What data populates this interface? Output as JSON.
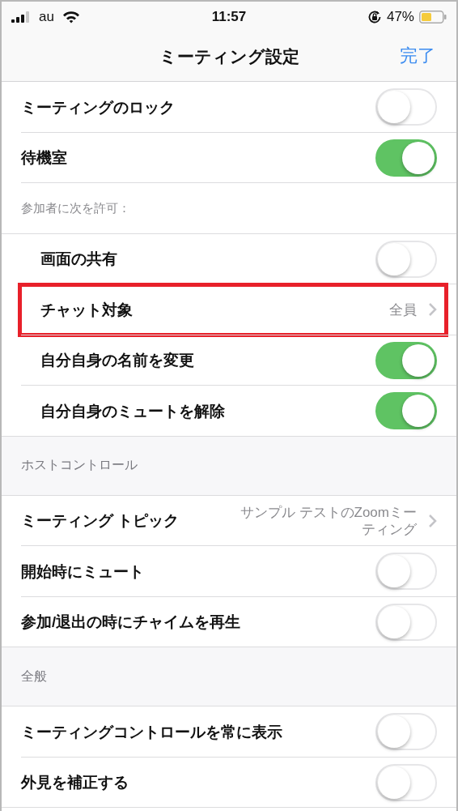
{
  "status_bar": {
    "carrier": "au",
    "time": "11:57",
    "battery": "47%"
  },
  "nav": {
    "title": "ミーティング設定",
    "done": "完了"
  },
  "sections": [
    {
      "items": [
        {
          "kind": "toggle",
          "label": "ミーティングのロック",
          "on": false
        },
        {
          "kind": "toggle",
          "label": "待機室",
          "on": true
        },
        {
          "kind": "caption",
          "label": "参加者に次を許可：",
          "children": [
            {
              "kind": "toggle",
              "label": "画面の共有",
              "on": false
            },
            {
              "kind": "value",
              "label": "チャット対象",
              "value": "全員",
              "highlighted": true
            },
            {
              "kind": "toggle",
              "label": "自分自身の名前を変更",
              "on": true
            },
            {
              "kind": "toggle",
              "label": "自分自身のミュートを解除",
              "on": true
            }
          ]
        }
      ]
    },
    {
      "header": "ホストコントロール",
      "items": [
        {
          "kind": "value",
          "label": "ミーティング トピック",
          "value": "サンプル テストのZoomミーティング",
          "highlighted": false
        },
        {
          "kind": "toggle",
          "label": "開始時にミュート",
          "on": false
        },
        {
          "kind": "toggle",
          "label": "参加/退出の時にチャイムを再生",
          "on": false
        }
      ]
    },
    {
      "header": "全般",
      "items": [
        {
          "kind": "toggle",
          "label": "ミーティングコントロールを常に表示",
          "on": false
        },
        {
          "kind": "toggle",
          "label": "外見を補正する",
          "on": false
        }
      ]
    }
  ]
}
